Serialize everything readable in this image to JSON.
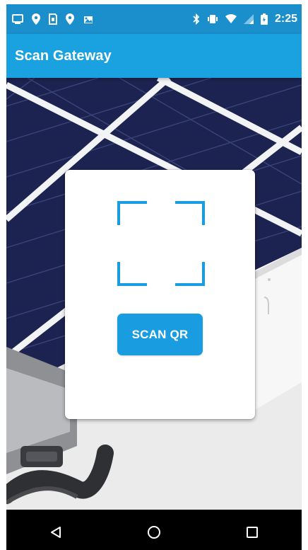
{
  "status_bar": {
    "left_icons": [
      "image-icon",
      "location-pin-icon",
      "sd-card-icon",
      "location-pin-icon",
      "photo-icon"
    ],
    "right_icons": [
      "bluetooth-icon",
      "vibrate-icon",
      "wifi-icon",
      "signal-icon",
      "battery-icon"
    ],
    "time": "2:25"
  },
  "app_bar": {
    "title": "Scan Gateway"
  },
  "scan_card": {
    "frame_icon": "qr-scan-frame-icon",
    "button_label": "SCAN QR"
  },
  "nav_bar": {
    "buttons": [
      "back-icon",
      "home-icon",
      "recents-icon"
    ]
  },
  "colors": {
    "status_bar": "#1a8fcc",
    "app_bar": "#1aa1df",
    "accent": "#1a9de0",
    "panel_dark": "#1d2350",
    "nav_bar": "#000000"
  }
}
